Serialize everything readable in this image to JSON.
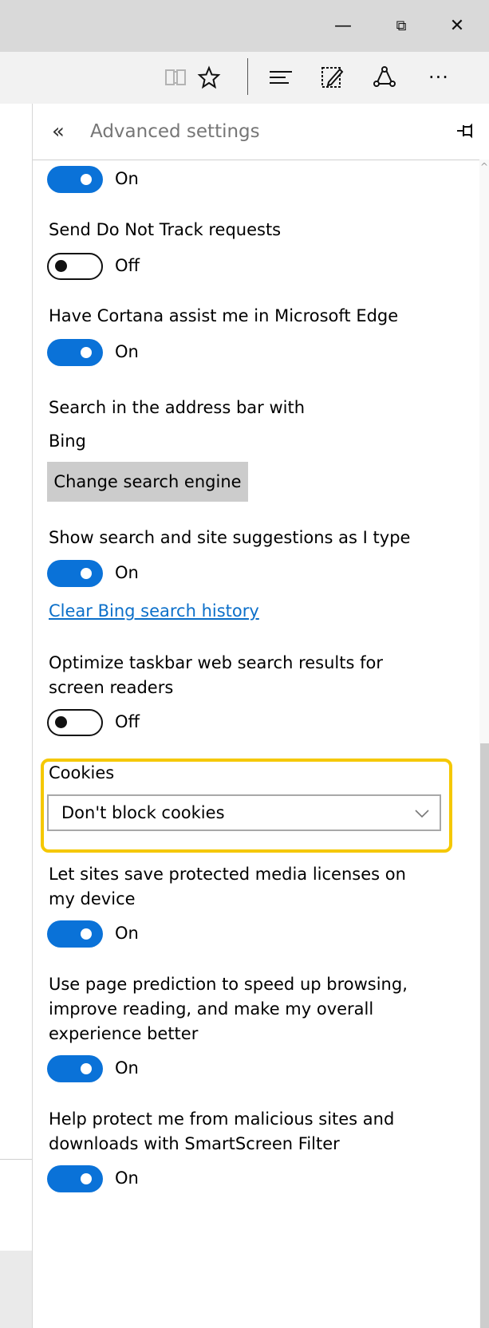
{
  "window": {
    "minimize_glyph": "—",
    "restore_glyph": "⧉",
    "close_glyph": "✕"
  },
  "toolbar": {
    "icons": [
      "reading-view-icon",
      "favorites-star-icon",
      "hub-icon",
      "web-note-icon",
      "share-icon",
      "more-icon"
    ],
    "more_glyph": "···"
  },
  "pane": {
    "back_glyph": "«",
    "title": "Advanced settings"
  },
  "settings": {
    "top_toggle_state": "On",
    "do_not_track": {
      "label": "Send Do Not Track requests",
      "state": "Off"
    },
    "cortana": {
      "label": "Have Cortana assist me in Microsoft Edge",
      "state": "On"
    },
    "search_engine": {
      "label": "Search in the address bar with",
      "value": "Bing",
      "button": "Change search engine"
    },
    "suggestions": {
      "label": "Show search and site suggestions as I type",
      "state": "On"
    },
    "clear_history_link": "Clear Bing search history",
    "taskbar": {
      "label": "Optimize taskbar web search results for screen readers",
      "state": "Off"
    },
    "cookies": {
      "label": "Cookies",
      "selected": "Don't block cookies"
    },
    "media_licenses": {
      "label": "Let sites save protected media licenses on my device",
      "state": "On"
    },
    "page_prediction": {
      "label": "Use page prediction to speed up browsing, improve reading, and make my overall experience better",
      "state": "On"
    },
    "smartscreen": {
      "label": "Help protect me from malicious sites and downloads with SmartScreen Filter",
      "state": "On"
    }
  },
  "colors": {
    "toggle_on": "#0a72d8",
    "highlight": "#f5c800",
    "link": "#0b6fc9"
  }
}
